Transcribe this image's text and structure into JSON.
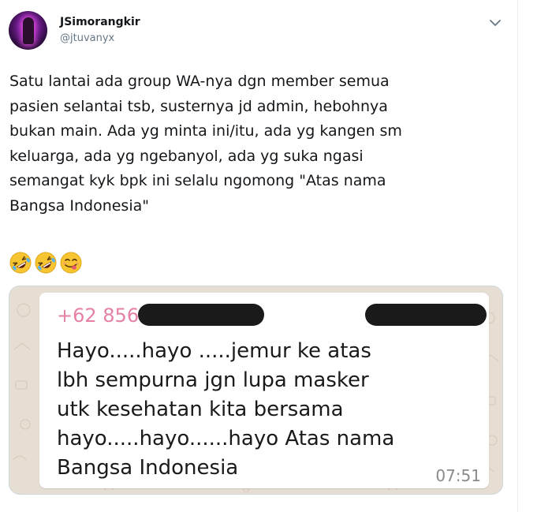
{
  "tweet": {
    "author_name": "JSimorangkir",
    "author_handle": "@jtuvanyx",
    "text": "Satu lantai ada group WA-nya dgn member semua\npasien selantai tsb, susternya jd admin, hebohnya\nbukan main. Ada yg minta ini/itu, ada yg kangen sm\nkeluarga, ada yg ngebanyol, ada yg suka ngasi\nsemangat kyk bpk ini selalu ngomong \"Atas nama\nBangsa Indonesia\"",
    "emojis": [
      "rolling-on-floor-laughing",
      "rolling-on-floor-laughing",
      "face-savoring-food"
    ],
    "menu_icon": "chevron-down-icon"
  },
  "media": {
    "sender_number": "+62 856",
    "message_text": "Hayo.....hayo .....jemur ke atas\nlbh sempurna jgn lupa masker\nutk kesehatan kita bersama\nhayo.....hayo......hayo Atas nama\nBangsa Indonesia",
    "time": "07:51",
    "colors": {
      "chat_background": "#e7ded3",
      "bubble": "#ffffff",
      "sender_number": "#e57fa6",
      "redaction": "#1a1a1a"
    }
  }
}
